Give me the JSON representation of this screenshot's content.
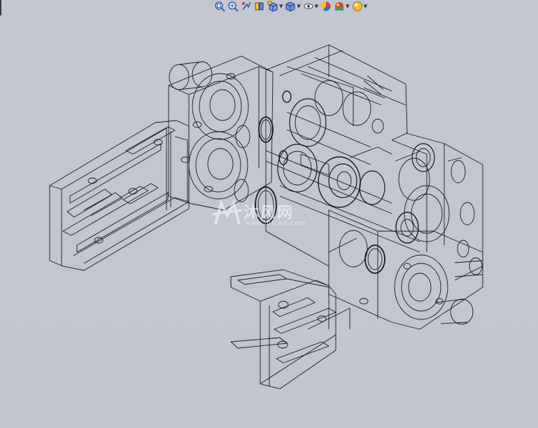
{
  "viewport": {
    "background": "#c3c6d1",
    "line_color": "#1a1a1a"
  },
  "toolbar": {
    "buttons": [
      {
        "name": "zoom-to-fit-icon",
        "has_menu": false
      },
      {
        "name": "zoom-to-area-icon",
        "has_menu": false
      },
      {
        "name": "previous-view-icon",
        "has_menu": false
      },
      {
        "name": "section-view-icon",
        "has_menu": false
      },
      {
        "name": "view-orientation-icon",
        "has_menu": true
      },
      {
        "name": "display-style-icon",
        "has_menu": true
      },
      {
        "name": "hide-show-items-icon",
        "has_menu": true
      },
      {
        "name": "edit-appearance-icon",
        "has_menu": false
      },
      {
        "name": "apply-scene-icon",
        "has_menu": true
      },
      {
        "name": "view-settings-icon",
        "has_menu": true
      }
    ]
  },
  "watermark": {
    "brand": "沐风网",
    "url": "www.mfcad.com"
  }
}
